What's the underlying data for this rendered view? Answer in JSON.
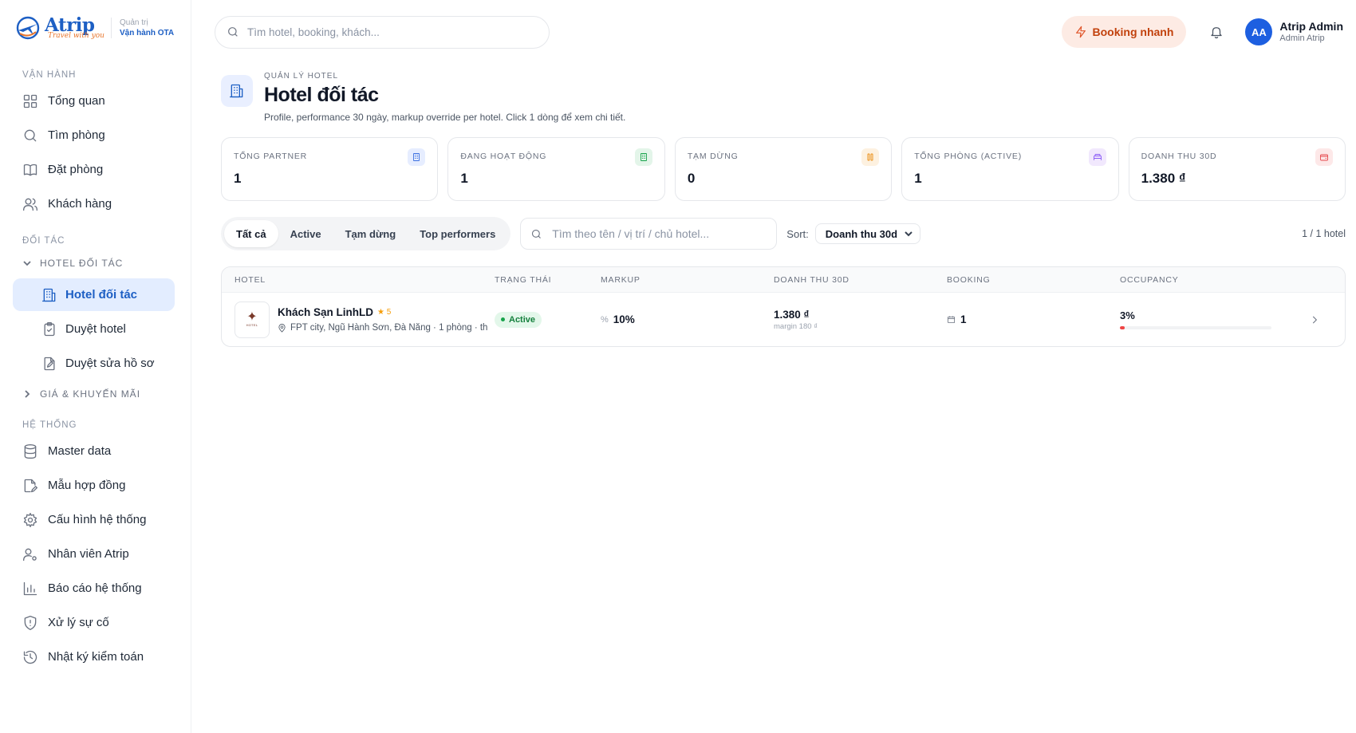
{
  "brand": {
    "name": "Atrip",
    "tagline": "Travel with you",
    "sub_top": "Quản trị",
    "sub_bottom": "Vận hành OTA"
  },
  "sidebar": {
    "sections": {
      "operate": "VẬN HÀNH",
      "partners": "ĐỐI TÁC",
      "system": "HỆ THỐNG"
    },
    "operate_items": [
      {
        "label": "Tổng quan",
        "icon": "grid-icon"
      },
      {
        "label": "Tìm phòng",
        "icon": "search-icon"
      },
      {
        "label": "Đặt phòng",
        "icon": "book-icon"
      },
      {
        "label": "Khách hàng",
        "icon": "users-icon"
      }
    ],
    "group_hotel": "HOTEL ĐỐI TÁC",
    "hotel_items": [
      {
        "label": "Hotel đối tác",
        "icon": "building-icon",
        "active": true
      },
      {
        "label": "Duyệt hotel",
        "icon": "clipboard-check-icon"
      },
      {
        "label": "Duyệt sửa hồ sơ",
        "icon": "file-edit-icon"
      }
    ],
    "group_price": "GIÁ & KHUYẾN MÃI",
    "system_items": [
      {
        "label": "Master data",
        "icon": "database-icon"
      },
      {
        "label": "Mẫu hợp đồng",
        "icon": "file-pen-icon"
      },
      {
        "label": "Cấu hình hệ thống",
        "icon": "gear-icon"
      },
      {
        "label": "Nhân viên Atrip",
        "icon": "user-cog-icon"
      },
      {
        "label": "Báo cáo hệ thống",
        "icon": "bar-chart-icon"
      },
      {
        "label": "Xử lý sự cố",
        "icon": "shield-alert-icon"
      },
      {
        "label": "Nhật ký kiểm toán",
        "icon": "history-icon"
      }
    ]
  },
  "topbar": {
    "search_placeholder": "Tìm hotel, booking, khách...",
    "quick_booking": "Booking nhanh",
    "user_initials": "AA",
    "user_name": "Atrip Admin",
    "user_role": "Admin Atrip"
  },
  "page": {
    "eyebrow": "QUẢN LÝ HOTEL",
    "title": "Hotel đối tác",
    "description": "Profile, performance 30 ngày, markup override per hotel. Click 1 dòng để xem chi tiết."
  },
  "stats": [
    {
      "label": "TỔNG PARTNER",
      "value": "1",
      "icon": "building-icon",
      "bg": "#e6edff",
      "fg": "#3b6fe0"
    },
    {
      "label": "ĐANG HOẠT ĐỘNG",
      "value": "1",
      "icon": "building-check-icon",
      "bg": "#e3f5e9",
      "fg": "#16a34a"
    },
    {
      "label": "TẠM DỪNG",
      "value": "0",
      "icon": "pause-icon",
      "bg": "#fdf1e0",
      "fg": "#ea8a0c"
    },
    {
      "label": "TỔNG PHÒNG (ACTIVE)",
      "value": "1",
      "icon": "bed-icon",
      "bg": "#f1e8fd",
      "fg": "#8b5cf6"
    },
    {
      "label": "DOANH THU 30D",
      "value": "1.380 ₫",
      "icon": "wallet-icon",
      "bg": "#fde8e8",
      "fg": "#e5484d"
    }
  ],
  "toolbar": {
    "tabs": [
      "Tất cả",
      "Active",
      "Tạm dừng",
      "Top performers"
    ],
    "active_tab": 0,
    "search_placeholder": "Tìm theo tên / vị trí / chủ hotel...",
    "sort_label": "Sort:",
    "sort_value": "Doanh thu 30d",
    "count": "1 / 1 hotel"
  },
  "table": {
    "columns": [
      "HOTEL",
      "TRẠNG THÁI",
      "MARKUP",
      "DOANH THU 30D",
      "BOOKING",
      "OCCUPANCY"
    ],
    "rows": [
      {
        "name": "Khách Sạn LinhLD",
        "stars": "★ 5",
        "location": "FPT city, Ngũ Hành Sơn, Đà Nẵng · 1 phòng · th",
        "status": "Active",
        "markup": "10%",
        "revenue": "1.380 ₫",
        "margin": "margin 180 ₫",
        "booking": "1",
        "occupancy": "3%",
        "occupancy_fraction": 0.03
      }
    ]
  }
}
